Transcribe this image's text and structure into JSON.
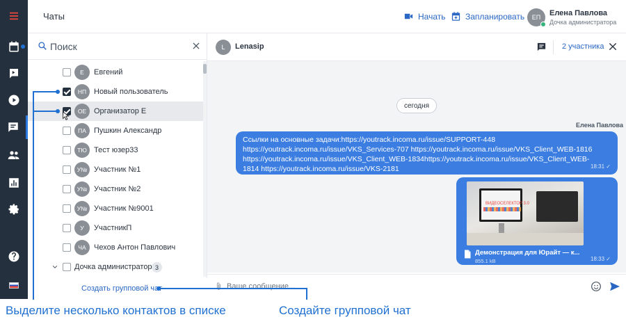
{
  "header": {
    "title": "Чаты",
    "start_label": "Начать",
    "schedule_label": "Запланировать",
    "user": {
      "initials": "ЕП",
      "name": "Елена Павлова",
      "role": "Дочка администратора"
    }
  },
  "rail": {
    "items": [
      "menu-icon",
      "calendar-icon",
      "video-icon",
      "play-icon",
      "chat-icon",
      "contacts-icon",
      "stats-icon",
      "settings-icon",
      "help-icon",
      "flag-icon"
    ],
    "active": "chat-icon"
  },
  "contacts": {
    "search_placeholder": "Поиск",
    "items": [
      {
        "initials": "Е",
        "name": "Евгений",
        "checked": false
      },
      {
        "initials": "НП",
        "name": "Новый пользователь",
        "checked": true
      },
      {
        "initials": "ОЕ",
        "name": "Организатор Е",
        "checked": true,
        "highlighted": true
      },
      {
        "initials": "ПА",
        "name": "Пушкин Александр",
        "checked": false
      },
      {
        "initials": "ТЮ",
        "name": "Тест юзер33",
        "checked": false
      },
      {
        "initials": "У№",
        "name": "Участник №1",
        "checked": false
      },
      {
        "initials": "У№",
        "name": "Участник №2",
        "checked": false
      },
      {
        "initials": "У№",
        "name": "Участник №9001",
        "checked": false
      },
      {
        "initials": "У",
        "name": "УчастникП",
        "checked": false
      },
      {
        "initials": "ЧА",
        "name": "Чехов Антон Павлович",
        "checked": false
      }
    ],
    "group": {
      "name": "Дочка администратора",
      "count": "3"
    },
    "create_group_label": "Создать групповой чат"
  },
  "chat": {
    "avatar_initial": "L",
    "name": "Lenasip",
    "participants_label": "2 участника",
    "date_label": "сегодня",
    "sender": "Елена Павлова",
    "message1": {
      "lines": [
        "Ссылки на основные задачи:https://youtrack.incoma.ru/issue/SUPPORT-448",
        "https://youtrack.incoma.ru/issue/VKS_Services-707 https://youtrack.incoma.ru/issue/VKS_Client_WEB-1816",
        "https://youtrack.incoma.ru/issue/VKS_Client_WEB-1834https://youtrack.incoma.ru/issue/VKS_Client_WEB-",
        "1814 https://youtrack.incoma.ru/issue/VKS-2181"
      ],
      "time": "18:31 ✓"
    },
    "message2": {
      "logo_text": "ВИДЕОСЕЛЕКТОР 3.0",
      "file_name": "Демонстрация для Юрайт — к...",
      "file_size": "855.1 kB",
      "time": "18:33 ✓"
    },
    "input_placeholder": "Ваше сообщение..."
  },
  "annotations": {
    "left": "Выделите несколько контактов в списке",
    "right": "Создайте групповой чат"
  },
  "colors": {
    "accent": "#2a67c4",
    "rail": "#24303d",
    "bubble": "#3b7de0",
    "annotation": "#1f70d1"
  }
}
